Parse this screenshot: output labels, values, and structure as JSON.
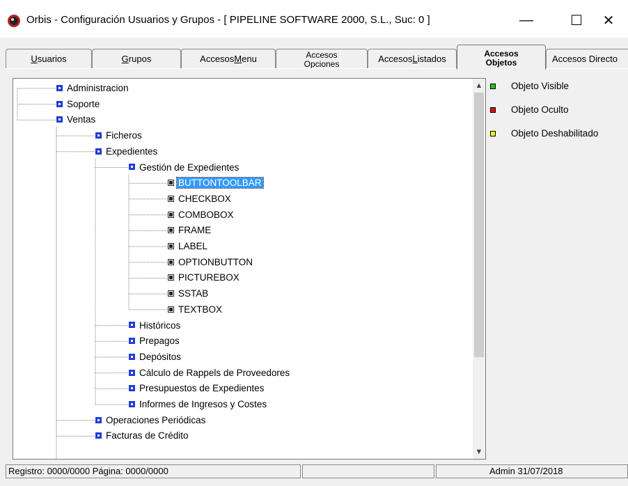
{
  "window": {
    "title": "Orbis - Configuración Usuarios y Grupos - [ PIPELINE SOFTWARE 2000, S.L.,  Suc: 0 ]",
    "minimize_symbol": "—",
    "maximize_symbol": "☐",
    "close_symbol": "✕"
  },
  "tabs": [
    {
      "pre": "",
      "u": "U",
      "post": "suarios"
    },
    {
      "pre": "",
      "u": "G",
      "post": "rupos"
    },
    {
      "pre": "Accesos ",
      "u": "M",
      "post": "enu"
    },
    {
      "line1": "Accesos",
      "line2": "Opciones"
    },
    {
      "pre": "Accesos ",
      "u": "L",
      "post": "istados"
    },
    {
      "line1": "Accesos",
      "line2": "Objetos"
    },
    {
      "pre": "Accesos Directo",
      "u": "",
      "post": ""
    }
  ],
  "active_tab_index": 5,
  "tree": {
    "nodes": [
      {
        "label": "Administracion",
        "icon": "blue-node-icon"
      },
      {
        "label": "Soporte",
        "icon": "blue-node-icon"
      },
      {
        "label": "Ventas",
        "icon": "blue-node-icon"
      },
      {
        "label": "Ficheros",
        "icon": "blue-node-icon"
      },
      {
        "label": "Expedientes",
        "icon": "blue-node-icon"
      },
      {
        "label": "Gestión de Expedientes",
        "icon": "blue-node-icon"
      },
      {
        "label": "BUTTONTOOLBAR",
        "icon": "object-node-icon",
        "selected": true
      },
      {
        "label": "CHECKBOX",
        "icon": "object-node-icon"
      },
      {
        "label": "COMBOBOX",
        "icon": "object-node-icon"
      },
      {
        "label": "FRAME",
        "icon": "object-node-icon"
      },
      {
        "label": "LABEL",
        "icon": "object-node-icon"
      },
      {
        "label": "OPTIONBUTTON",
        "icon": "object-node-icon"
      },
      {
        "label": "PICTUREBOX",
        "icon": "object-node-icon"
      },
      {
        "label": "SSTAB",
        "icon": "object-node-icon"
      },
      {
        "label": "TEXTBOX",
        "icon": "object-node-icon"
      },
      {
        "label": "Históricos",
        "icon": "blue-node-icon"
      },
      {
        "label": "Prepagos",
        "icon": "blue-node-icon"
      },
      {
        "label": "Depósitos",
        "icon": "blue-node-icon"
      },
      {
        "label": "Cálculo de Rappels de Proveedores",
        "icon": "blue-node-icon"
      },
      {
        "label": "Presupuestos de Expedientes",
        "icon": "blue-node-icon"
      },
      {
        "label": "Informes de Ingresos y Costes",
        "icon": "blue-node-icon"
      },
      {
        "label": "Operaciones Periódicas",
        "icon": "blue-node-icon"
      },
      {
        "label": "Facturas de Crédito",
        "icon": "blue-node-icon"
      }
    ],
    "scroll_up_symbol": "▲",
    "scroll_down_symbol": "▼"
  },
  "legend": [
    {
      "label": "Objeto Visible",
      "color": "#22c222"
    },
    {
      "label": "Objeto Oculto",
      "color": "#e01010"
    },
    {
      "label": "Objeto Deshabilitado",
      "color": "#f0f000"
    }
  ],
  "statusbar": {
    "registro": "Registro: 0000/0000  Página: 0000/0000",
    "user_date": "Admin 31/07/2018"
  }
}
